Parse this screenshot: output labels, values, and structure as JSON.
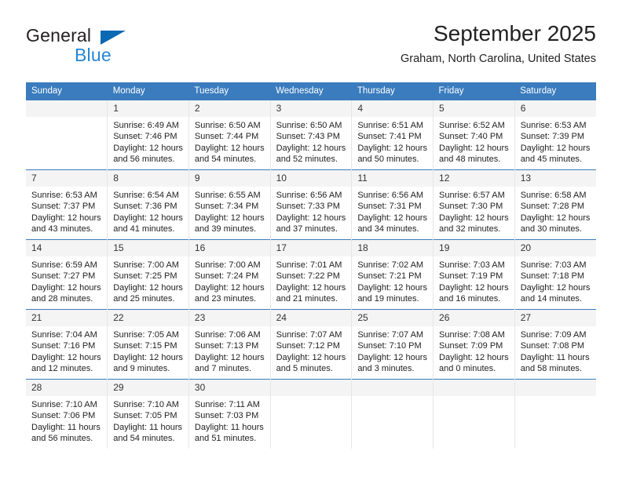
{
  "brand": {
    "name_primary": "General",
    "name_secondary": "Blue",
    "triangle_color": "#0b68b2",
    "primary_color": "#231f20",
    "secondary_color": "#2585d3"
  },
  "header": {
    "title": "September 2025",
    "subtitle": "Graham, North Carolina, United States",
    "header_bg_color": "#3a7cbe",
    "daynum_bg_color": "#f4f4f4"
  },
  "weekdays": [
    "Sunday",
    "Monday",
    "Tuesday",
    "Wednesday",
    "Thursday",
    "Friday",
    "Saturday"
  ],
  "weeks": [
    [
      {
        "day": "",
        "sunrise": "",
        "sunset": "",
        "daylight1": "",
        "daylight2": "",
        "blank": true
      },
      {
        "day": "1",
        "sunrise": "Sunrise: 6:49 AM",
        "sunset": "Sunset: 7:46 PM",
        "daylight1": "Daylight: 12 hours",
        "daylight2": "and 56 minutes."
      },
      {
        "day": "2",
        "sunrise": "Sunrise: 6:50 AM",
        "sunset": "Sunset: 7:44 PM",
        "daylight1": "Daylight: 12 hours",
        "daylight2": "and 54 minutes."
      },
      {
        "day": "3",
        "sunrise": "Sunrise: 6:50 AM",
        "sunset": "Sunset: 7:43 PM",
        "daylight1": "Daylight: 12 hours",
        "daylight2": "and 52 minutes."
      },
      {
        "day": "4",
        "sunrise": "Sunrise: 6:51 AM",
        "sunset": "Sunset: 7:41 PM",
        "daylight1": "Daylight: 12 hours",
        "daylight2": "and 50 minutes."
      },
      {
        "day": "5",
        "sunrise": "Sunrise: 6:52 AM",
        "sunset": "Sunset: 7:40 PM",
        "daylight1": "Daylight: 12 hours",
        "daylight2": "and 48 minutes."
      },
      {
        "day": "6",
        "sunrise": "Sunrise: 6:53 AM",
        "sunset": "Sunset: 7:39 PM",
        "daylight1": "Daylight: 12 hours",
        "daylight2": "and 45 minutes."
      }
    ],
    [
      {
        "day": "7",
        "sunrise": "Sunrise: 6:53 AM",
        "sunset": "Sunset: 7:37 PM",
        "daylight1": "Daylight: 12 hours",
        "daylight2": "and 43 minutes."
      },
      {
        "day": "8",
        "sunrise": "Sunrise: 6:54 AM",
        "sunset": "Sunset: 7:36 PM",
        "daylight1": "Daylight: 12 hours",
        "daylight2": "and 41 minutes."
      },
      {
        "day": "9",
        "sunrise": "Sunrise: 6:55 AM",
        "sunset": "Sunset: 7:34 PM",
        "daylight1": "Daylight: 12 hours",
        "daylight2": "and 39 minutes."
      },
      {
        "day": "10",
        "sunrise": "Sunrise: 6:56 AM",
        "sunset": "Sunset: 7:33 PM",
        "daylight1": "Daylight: 12 hours",
        "daylight2": "and 37 minutes."
      },
      {
        "day": "11",
        "sunrise": "Sunrise: 6:56 AM",
        "sunset": "Sunset: 7:31 PM",
        "daylight1": "Daylight: 12 hours",
        "daylight2": "and 34 minutes."
      },
      {
        "day": "12",
        "sunrise": "Sunrise: 6:57 AM",
        "sunset": "Sunset: 7:30 PM",
        "daylight1": "Daylight: 12 hours",
        "daylight2": "and 32 minutes."
      },
      {
        "day": "13",
        "sunrise": "Sunrise: 6:58 AM",
        "sunset": "Sunset: 7:28 PM",
        "daylight1": "Daylight: 12 hours",
        "daylight2": "and 30 minutes."
      }
    ],
    [
      {
        "day": "14",
        "sunrise": "Sunrise: 6:59 AM",
        "sunset": "Sunset: 7:27 PM",
        "daylight1": "Daylight: 12 hours",
        "daylight2": "and 28 minutes."
      },
      {
        "day": "15",
        "sunrise": "Sunrise: 7:00 AM",
        "sunset": "Sunset: 7:25 PM",
        "daylight1": "Daylight: 12 hours",
        "daylight2": "and 25 minutes."
      },
      {
        "day": "16",
        "sunrise": "Sunrise: 7:00 AM",
        "sunset": "Sunset: 7:24 PM",
        "daylight1": "Daylight: 12 hours",
        "daylight2": "and 23 minutes."
      },
      {
        "day": "17",
        "sunrise": "Sunrise: 7:01 AM",
        "sunset": "Sunset: 7:22 PM",
        "daylight1": "Daylight: 12 hours",
        "daylight2": "and 21 minutes."
      },
      {
        "day": "18",
        "sunrise": "Sunrise: 7:02 AM",
        "sunset": "Sunset: 7:21 PM",
        "daylight1": "Daylight: 12 hours",
        "daylight2": "and 19 minutes."
      },
      {
        "day": "19",
        "sunrise": "Sunrise: 7:03 AM",
        "sunset": "Sunset: 7:19 PM",
        "daylight1": "Daylight: 12 hours",
        "daylight2": "and 16 minutes."
      },
      {
        "day": "20",
        "sunrise": "Sunrise: 7:03 AM",
        "sunset": "Sunset: 7:18 PM",
        "daylight1": "Daylight: 12 hours",
        "daylight2": "and 14 minutes."
      }
    ],
    [
      {
        "day": "21",
        "sunrise": "Sunrise: 7:04 AM",
        "sunset": "Sunset: 7:16 PM",
        "daylight1": "Daylight: 12 hours",
        "daylight2": "and 12 minutes."
      },
      {
        "day": "22",
        "sunrise": "Sunrise: 7:05 AM",
        "sunset": "Sunset: 7:15 PM",
        "daylight1": "Daylight: 12 hours",
        "daylight2": "and 9 minutes."
      },
      {
        "day": "23",
        "sunrise": "Sunrise: 7:06 AM",
        "sunset": "Sunset: 7:13 PM",
        "daylight1": "Daylight: 12 hours",
        "daylight2": "and 7 minutes."
      },
      {
        "day": "24",
        "sunrise": "Sunrise: 7:07 AM",
        "sunset": "Sunset: 7:12 PM",
        "daylight1": "Daylight: 12 hours",
        "daylight2": "and 5 minutes."
      },
      {
        "day": "25",
        "sunrise": "Sunrise: 7:07 AM",
        "sunset": "Sunset: 7:10 PM",
        "daylight1": "Daylight: 12 hours",
        "daylight2": "and 3 minutes."
      },
      {
        "day": "26",
        "sunrise": "Sunrise: 7:08 AM",
        "sunset": "Sunset: 7:09 PM",
        "daylight1": "Daylight: 12 hours",
        "daylight2": "and 0 minutes."
      },
      {
        "day": "27",
        "sunrise": "Sunrise: 7:09 AM",
        "sunset": "Sunset: 7:08 PM",
        "daylight1": "Daylight: 11 hours",
        "daylight2": "and 58 minutes."
      }
    ],
    [
      {
        "day": "28",
        "sunrise": "Sunrise: 7:10 AM",
        "sunset": "Sunset: 7:06 PM",
        "daylight1": "Daylight: 11 hours",
        "daylight2": "and 56 minutes."
      },
      {
        "day": "29",
        "sunrise": "Sunrise: 7:10 AM",
        "sunset": "Sunset: 7:05 PM",
        "daylight1": "Daylight: 11 hours",
        "daylight2": "and 54 minutes."
      },
      {
        "day": "30",
        "sunrise": "Sunrise: 7:11 AM",
        "sunset": "Sunset: 7:03 PM",
        "daylight1": "Daylight: 11 hours",
        "daylight2": "and 51 minutes."
      },
      {
        "day": "",
        "sunrise": "",
        "sunset": "",
        "daylight1": "",
        "daylight2": "",
        "blank": true
      },
      {
        "day": "",
        "sunrise": "",
        "sunset": "",
        "daylight1": "",
        "daylight2": "",
        "blank": true
      },
      {
        "day": "",
        "sunrise": "",
        "sunset": "",
        "daylight1": "",
        "daylight2": "",
        "blank": true
      },
      {
        "day": "",
        "sunrise": "",
        "sunset": "",
        "daylight1": "",
        "daylight2": "",
        "blank": true
      }
    ]
  ]
}
